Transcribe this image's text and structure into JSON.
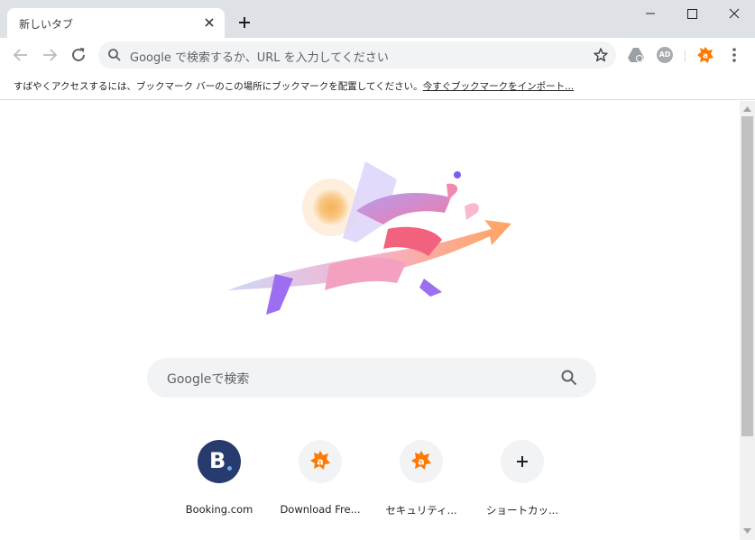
{
  "tab": {
    "title": "新しいタブ"
  },
  "omnibox": {
    "placeholder": "Google で検索するか、URL を入力してください"
  },
  "bookmarks_bar": {
    "message": "すばやくアクセスするには、ブックマーク バーのこの場所にブックマークを配置してください。",
    "import_link": "今すぐブックマークをインポート..."
  },
  "ntp_search": {
    "placeholder": "Googleで検索"
  },
  "shortcuts": [
    {
      "title": "Booking.com",
      "icon": "booking-logo"
    },
    {
      "title": "Download Fre...",
      "icon": "avast-logo"
    },
    {
      "title": "セキュリティ...",
      "icon": "avast-logo"
    },
    {
      "title": "ショートカッ...",
      "icon": "plus-icon"
    }
  ],
  "extensions": {
    "adblock_label": "AD"
  },
  "colors": {
    "chrome_frame": "#dee1e6",
    "omnibox_bg": "#f1f3f4",
    "avast_orange": "#ff7800",
    "booking_navy": "#273b6e"
  }
}
